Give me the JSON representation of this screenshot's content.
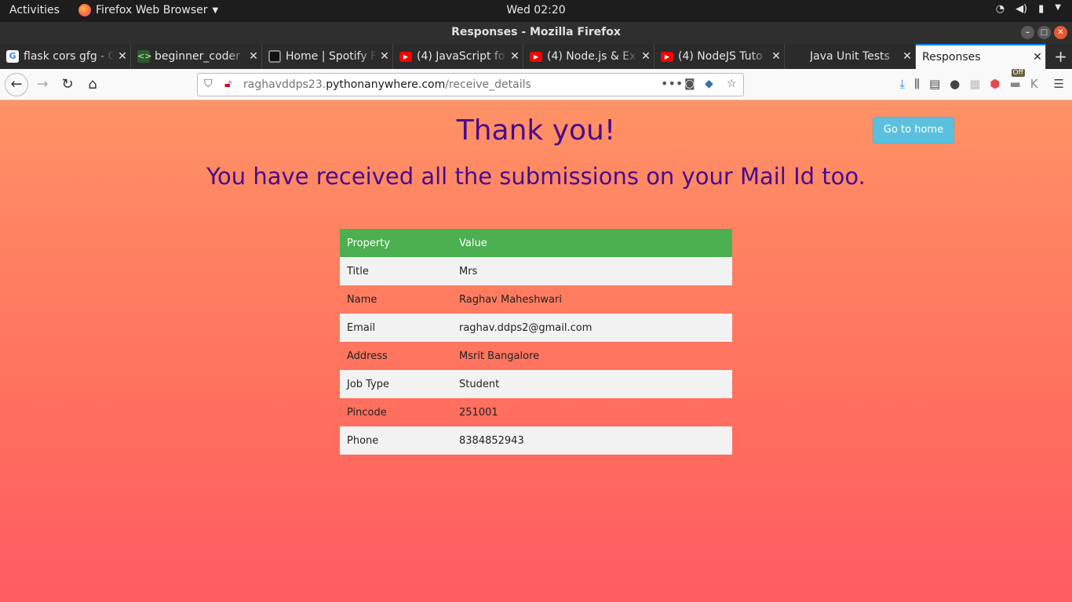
{
  "system": {
    "activities": "Activities",
    "app_name": "Firefox Web Browser",
    "clock": "Wed 02:20"
  },
  "window": {
    "title": "Responses - Mozilla Firefox"
  },
  "tabs": [
    {
      "label": "flask cors gfg - G",
      "icon": "google-icon"
    },
    {
      "label": "beginner_coder",
      "icon": "code-icon"
    },
    {
      "label": "Home | Spotify F",
      "icon": "spotify-icon"
    },
    {
      "label": "(4) JavaScript fo",
      "icon": "youtube-icon"
    },
    {
      "label": "(4) Node.js & Ex",
      "icon": "youtube-icon"
    },
    {
      "label": "(4) NodeJS Tuto",
      "icon": "youtube-icon"
    },
    {
      "label": "Java Unit Tests",
      "icon": "none"
    },
    {
      "label": "Responses",
      "icon": "none",
      "active": true
    }
  ],
  "navbar": {
    "url_prefix": "raghavddps23.",
    "url_domain": "pythonanywhere.com",
    "url_path": "/receive_details",
    "addon_badge": "Off"
  },
  "page": {
    "heading": "Thank you!",
    "subheading": "You have received all the submissions on your Mail Id too.",
    "home_button": "Go to home",
    "table": {
      "headers": [
        "Property",
        "Value"
      ],
      "rows": [
        [
          "Title",
          "Mrs"
        ],
        [
          "Name",
          "Raghav Maheshwari"
        ],
        [
          "Email",
          "raghav.ddps2@gmail.com"
        ],
        [
          "Address",
          "Msrit Bangalore"
        ],
        [
          "Job Type",
          "Student"
        ],
        [
          "Pincode",
          "251001"
        ],
        [
          "Phone",
          "8384852943"
        ]
      ]
    }
  },
  "colors": {
    "heading": "#4a0a8c",
    "table_header": "#4caf50",
    "home_button": "#5bc0de",
    "tab_accent": "#0a84ff"
  }
}
